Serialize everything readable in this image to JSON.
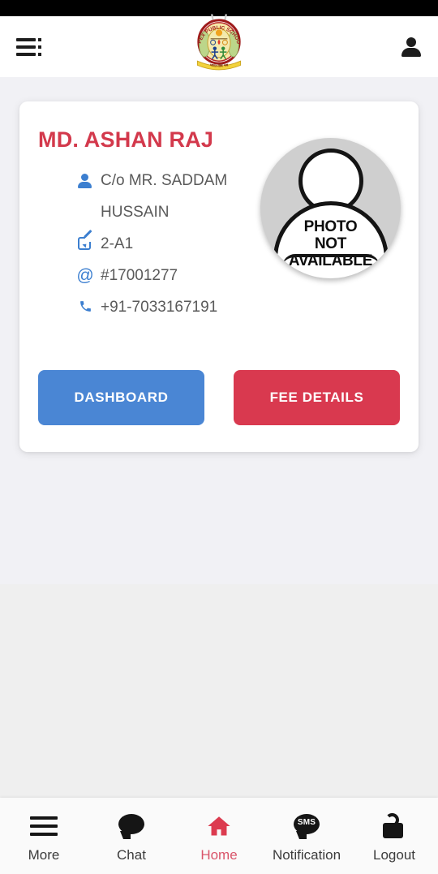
{
  "app": {
    "school_logo_alt": "APEX PUBLIC SCHOOL",
    "logo_text_top": "APEX PUBLIC",
    "logo_text_arc": "SCHOOL",
    "logo_banner_text": "भारत तीर्थ भव"
  },
  "header": {
    "menu_icon": "hamburger-list-icon",
    "profile_icon": "person-icon"
  },
  "profile_card": {
    "student_name": "MD. ASHAN RAJ",
    "info": [
      {
        "icon": "person-icon",
        "text": "C/o MR. SADDAM HUSSAIN"
      },
      {
        "icon": "edit-icon",
        "text": "2-A1"
      },
      {
        "icon": "at-icon",
        "text": "#17001277"
      },
      {
        "icon": "phone-icon",
        "text": "+91-7033167191"
      }
    ],
    "avatar": {
      "icon": "photo-placeholder-icon",
      "line1": "PHOTO",
      "line2": "NOT",
      "line3": "AVAILABLE"
    },
    "buttons": {
      "dashboard": "DASHBOARD",
      "fee_details": "FEE DETAILS"
    }
  },
  "bottom_nav": {
    "items": [
      {
        "label": "More",
        "icon": "hamburger-icon",
        "active": false
      },
      {
        "label": "Chat",
        "icon": "chat-bubble-icon",
        "active": false
      },
      {
        "label": "Home",
        "icon": "home-icon",
        "active": true
      },
      {
        "label": "Notification",
        "icon": "sms-bubble-icon",
        "active": false
      },
      {
        "label": "Logout",
        "icon": "unlocked-padlock-icon",
        "active": false
      }
    ]
  },
  "colors": {
    "accent_red": "#d3394c",
    "button_blue": "#4a86d4",
    "button_red": "#d9394f",
    "icon_blue": "#3c7fd0",
    "active_nav": "#d9556a",
    "page_bg": "#f1f1f5"
  }
}
